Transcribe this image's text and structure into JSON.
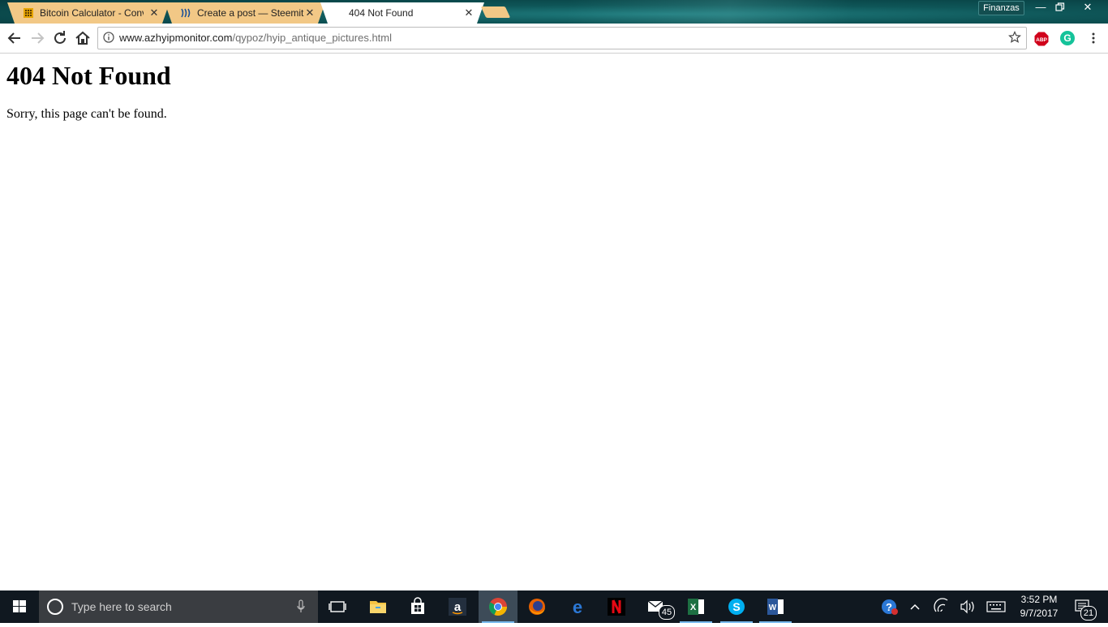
{
  "browser": {
    "tabs": [
      {
        "title": "Bitcoin Calculator - Conv",
        "favicon": "calculator-icon",
        "active": false
      },
      {
        "title": "Create a post — Steemit",
        "favicon": "steemit-icon",
        "active": false
      },
      {
        "title": "404 Not Found",
        "favicon": "",
        "active": true
      }
    ],
    "profile": "Finanzas",
    "url_domain": "www.azhyipmonitor.com",
    "url_path": "/qypoz/hyip_antique_pictures.html",
    "extensions": {
      "adblock": "ABP",
      "grammarly": "G"
    }
  },
  "page": {
    "heading": "404 Not Found",
    "message": "Sorry, this page can't be found."
  },
  "taskbar": {
    "search_placeholder": "Type here to search",
    "mail_badge": "45",
    "notification_badge": "21",
    "time": "3:52 PM",
    "date": "9/7/2017",
    "accent": "#76b9ed"
  }
}
